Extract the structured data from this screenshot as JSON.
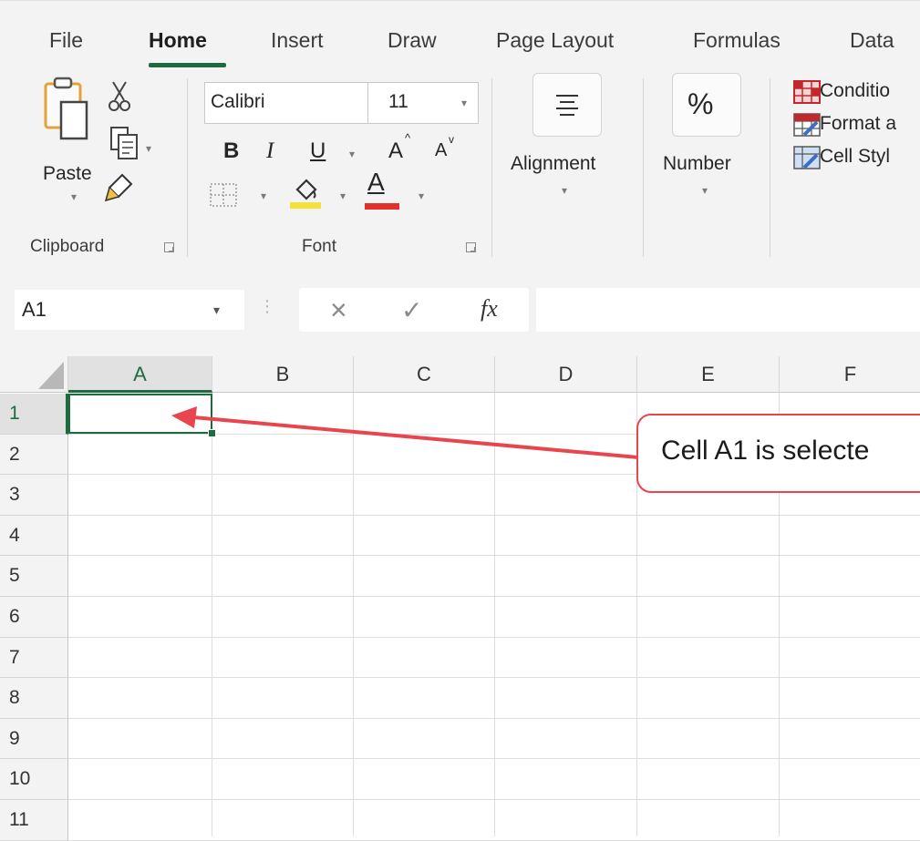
{
  "ribbon_tabs": [
    "File",
    "Home",
    "Insert",
    "Draw",
    "Page Layout",
    "Formulas",
    "Data"
  ],
  "active_tab": "Home",
  "clipboard": {
    "paste_label": "Paste",
    "group_label": "Clipboard"
  },
  "font": {
    "font_name": "Calibri",
    "font_size": "11",
    "bold": "B",
    "italic": "I",
    "underline": "U",
    "grow": "A",
    "shrink": "A",
    "font_color_glyph": "A",
    "group_label": "Font",
    "fill_color": "#f4e23a",
    "text_color": "#e0302a"
  },
  "alignment": {
    "label": "Alignment",
    "icon": "align-center-icon"
  },
  "number": {
    "glyph": "%",
    "label": "Number"
  },
  "styles": {
    "items": [
      "Conditio",
      "Format a",
      "Cell Styl"
    ]
  },
  "formula_bar": {
    "name_box": "A1",
    "cancel": "×",
    "enter": "✓",
    "fx": "fx",
    "value": ""
  },
  "columns": [
    "A",
    "B",
    "C",
    "D",
    "E",
    "F"
  ],
  "rows": [
    "1",
    "2",
    "3",
    "4",
    "5",
    "6",
    "7",
    "8",
    "9",
    "10",
    "11"
  ],
  "selected_cell": "A1",
  "callout": {
    "text": "Cell A1 is selecte"
  },
  "colors": {
    "accent": "#1e6b3f",
    "callout": "#e8454f"
  }
}
